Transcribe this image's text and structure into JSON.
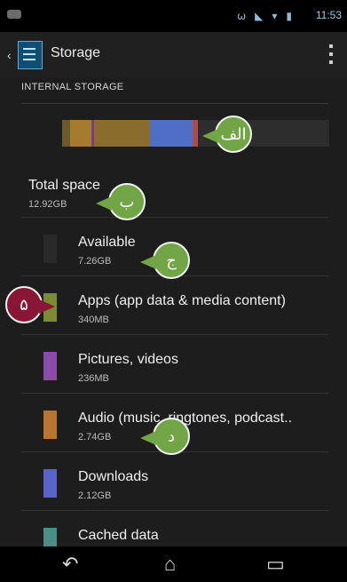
{
  "status_bar": {
    "time": "11:53",
    "icons": [
      "bluetooth-icon",
      "signal-icon",
      "wifi-icon",
      "battery-icon"
    ]
  },
  "header": {
    "title": "Storage"
  },
  "section": {
    "label": "INTERNAL STORAGE"
  },
  "usage_bar": {
    "segments": [
      {
        "color": "#6a5a2e",
        "fraction": 0.03
      },
      {
        "color": "#a57b2d",
        "fraction": 0.08
      },
      {
        "color": "#7a3e8d",
        "fraction": 0.01
      },
      {
        "color": "#8a6d2d",
        "fraction": 0.21
      },
      {
        "color": "#4f6ec6",
        "fraction": 0.16
      },
      {
        "color": "#b14a4a",
        "fraction": 0.02
      },
      {
        "color": "#2d2d2d",
        "fraction": 0.49
      }
    ]
  },
  "total": {
    "title": "Total space",
    "size": "12.92GB"
  },
  "items": [
    {
      "title": "Available",
      "size": "7.26GB",
      "color": "#2a2a2a"
    },
    {
      "title": "Apps  (app data & media content)",
      "size": "340MB",
      "color": "#7d8c33"
    },
    {
      "title": "Pictures, videos",
      "size": "236MB",
      "color": "#8c4aa9"
    },
    {
      "title": "Audio  (music, ringtones, podcast..",
      "size": "2.74GB",
      "color": "#b7752d"
    },
    {
      "title": "Downloads",
      "size": "2.12GB",
      "color": "#5a63c9"
    },
    {
      "title": "Cached data",
      "size": "",
      "color": "#4a8f87"
    }
  ],
  "callouts": {
    "alef": "الف",
    "be": "ب",
    "jim": "ج",
    "dal": "د",
    "number_5": "۵"
  }
}
